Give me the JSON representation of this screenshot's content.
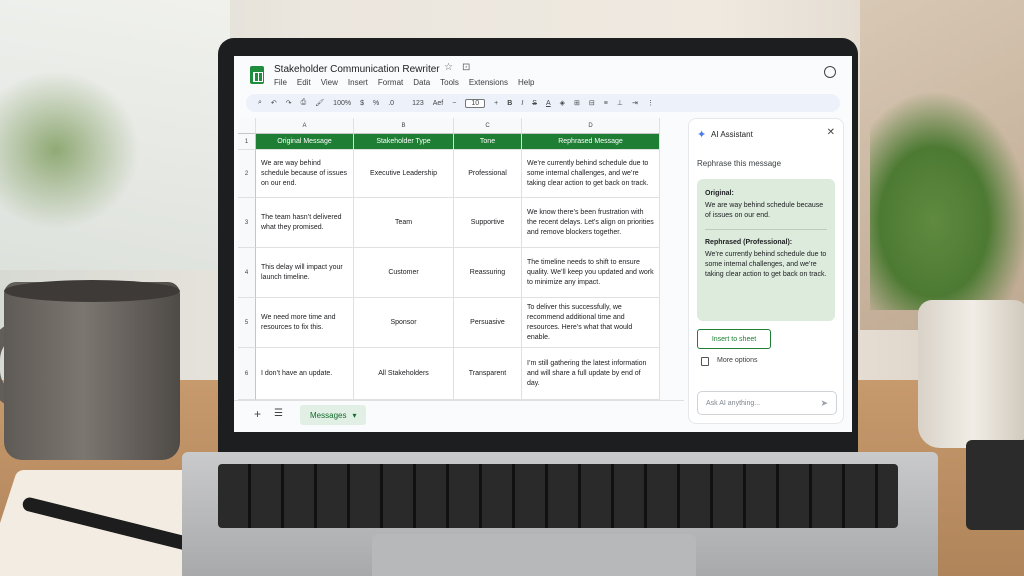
{
  "app": {
    "title": "Stakeholder Communication Rewriter",
    "menu": [
      "File",
      "Edit",
      "View",
      "Insert",
      "Format",
      "Data",
      "Tools",
      "Extensions",
      "Help"
    ]
  },
  "toolbar": {
    "zoom": "100%",
    "currency": "$",
    "percent": "%",
    "dec_dec": ".0",
    ".00": ".00",
    "num_format": "123",
    "font": "Aef",
    "font_size": "10"
  },
  "grid": {
    "col_letters": [
      "A",
      "B",
      "C",
      "D"
    ],
    "row_numbers": [
      "1",
      "2",
      "3",
      "4",
      "5",
      "6"
    ],
    "headers": [
      "Original Message",
      "Stakeholder Type",
      "Tone",
      "Rephrased Message"
    ],
    "rows": [
      [
        "We are way behind schedule because of issues on our end.",
        "Executive Leadership",
        "Professional",
        "We’re currently behind schedule due to some internal challenges, and we’re taking clear action to get back on track."
      ],
      [
        "The team hasn’t delivered what they promised.",
        "Team",
        "Supportive",
        "We know there’s been frustration with the recent delays. Let’s align on priorities and remove blockers together."
      ],
      [
        "This delay will impact your launch timeline.",
        "Customer",
        "Reassuring",
        "The timeline needs to shift to ensure quality. We’ll keep you updated and work to minimize any impact."
      ],
      [
        "We need more time and resources to fix this.",
        "Sponsor",
        "Persuasive",
        "To deliver this successfully, we recommend additional time and resources. Here’s what that would enable."
      ],
      [
        "I don’t have an update.",
        "All Stakeholders",
        "Transparent",
        "I’m still gathering the latest information and will share a full update by end of day."
      ]
    ]
  },
  "sheet_tab": {
    "label": "Messages"
  },
  "panel": {
    "title": "AI Assistant",
    "prompt": "Rephrase this message",
    "original_label": "Original:",
    "original_text": "We are way behind schedule because of issues on our end.",
    "rephrased_label": "Rephrased (Professional):",
    "rephrased_text": "We’re currently behind schedule due to some internal challenges, and we’re taking clear action to get back on track.",
    "insert_label": "Insert to sheet",
    "more_label": "More options",
    "ask_placeholder": "Ask AI anything..."
  },
  "colors": {
    "accent_green": "#1e7e34",
    "card_green": "#dcebdc",
    "spark_blue": "#4a7be8"
  }
}
